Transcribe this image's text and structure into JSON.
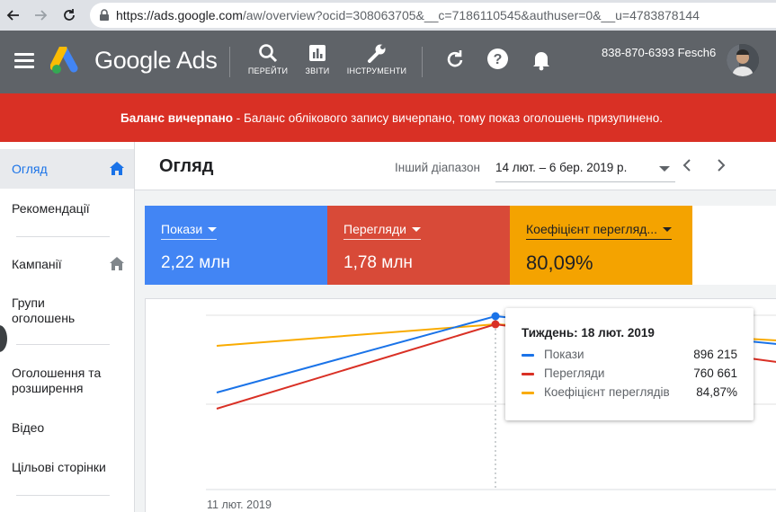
{
  "browser": {
    "url_host": "https://ads.google.com",
    "url_rest": "/aw/overview?ocid=308063705&__c=7186110545&authuser=0&__u=4783878144"
  },
  "header": {
    "brand": "Google Ads",
    "tools": [
      {
        "icon": "search-icon",
        "label": "ПЕРЕЙТИ"
      },
      {
        "icon": "reports-icon",
        "label": "ЗВІТИ"
      },
      {
        "icon": "wrench-icon",
        "label": "ІНСТРУМЕНТИ"
      }
    ],
    "account": "838-870-6393 Fesch6"
  },
  "alert": {
    "bold": "Баланс вичерпано",
    "text": " - Баланс облікового запису вичерпано, тому показ оголошень призупинено."
  },
  "sidebar": {
    "items": [
      {
        "label": "Огляд",
        "active": true
      },
      {
        "label": "Рекомендації"
      },
      {
        "label": "Кампанії"
      },
      {
        "label": "Групи оголошень"
      },
      {
        "label": "Оголошення та розширення"
      },
      {
        "label": "Відео"
      },
      {
        "label": "Цільові сторінки"
      }
    ]
  },
  "page": {
    "title": "Огляд",
    "range_label": "Інший діапазон",
    "range_value": "14 лют. – 6 бер. 2019 р."
  },
  "metrics": [
    {
      "label": "Покази",
      "value": "2,22 млн",
      "color": "#4285f4"
    },
    {
      "label": "Перегляди",
      "value": "1,78 млн",
      "color": "#d84a38"
    },
    {
      "label": "Коефіцієнт перегляд...",
      "value": "80,09%",
      "color": "#f4a300"
    }
  ],
  "chart": {
    "x_label_first": "11 лют. 2019"
  },
  "tooltip": {
    "title": "Тиждень: 18 лют. 2019",
    "rows": [
      {
        "name": "Покази",
        "value": "896 215",
        "color": "#1a73e8"
      },
      {
        "name": "Перегляди",
        "value": "760 661",
        "color": "#d93025"
      },
      {
        "name": "Коефіцієнт переглядів",
        "value": "84,87%",
        "color": "#f9ab00"
      }
    ]
  },
  "colors": {
    "blue": "#1a73e8",
    "red": "#d93025",
    "orange": "#f9ab00",
    "header": "#5f6368"
  }
}
